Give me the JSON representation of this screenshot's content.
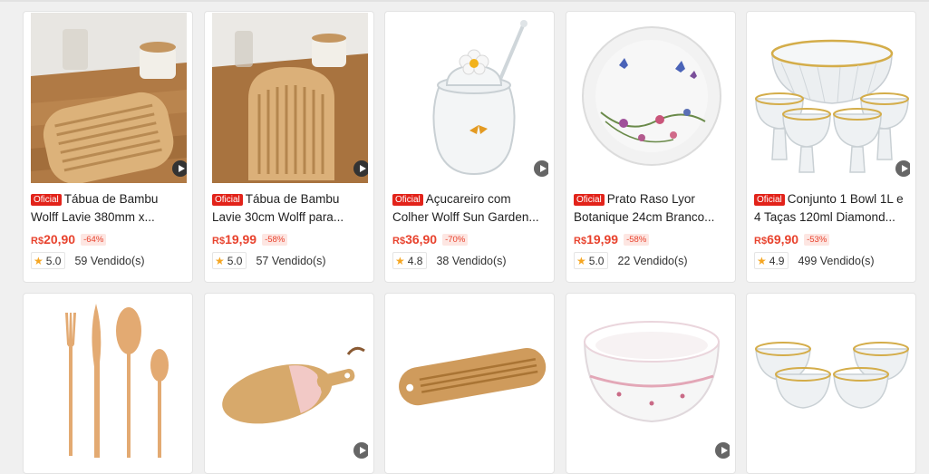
{
  "badge_label": "Oficial",
  "currency": "R$",
  "products": [
    {
      "title": "Tábua de Bambu Wolff Lavie 380mm x...",
      "price": "20,90",
      "discount": "-64%",
      "rating": "5.0",
      "sold": "59 Vendido(s)"
    },
    {
      "title": "Tábua de Bambu Lavie 30cm Wolff para...",
      "price": "19,99",
      "discount": "-58%",
      "rating": "5.0",
      "sold": "57 Vendido(s)"
    },
    {
      "title": "Açucareiro com Colher Wolff Sun Garden...",
      "price": "36,90",
      "discount": "-70%",
      "rating": "4.8",
      "sold": "38 Vendido(s)"
    },
    {
      "title": "Prato Raso Lyor Botanique 24cm Branco...",
      "price": "19,99",
      "discount": "-58%",
      "rating": "5.0",
      "sold": "22 Vendido(s)"
    },
    {
      "title": "Conjunto 1 Bowl 1L e 4 Taças 120ml Diamond...",
      "price": "69,90",
      "discount": "-53%",
      "rating": "4.9",
      "sold": "499 Vendido(s)"
    }
  ],
  "icons": {
    "play": "play-video-icon",
    "star": "star-icon"
  }
}
